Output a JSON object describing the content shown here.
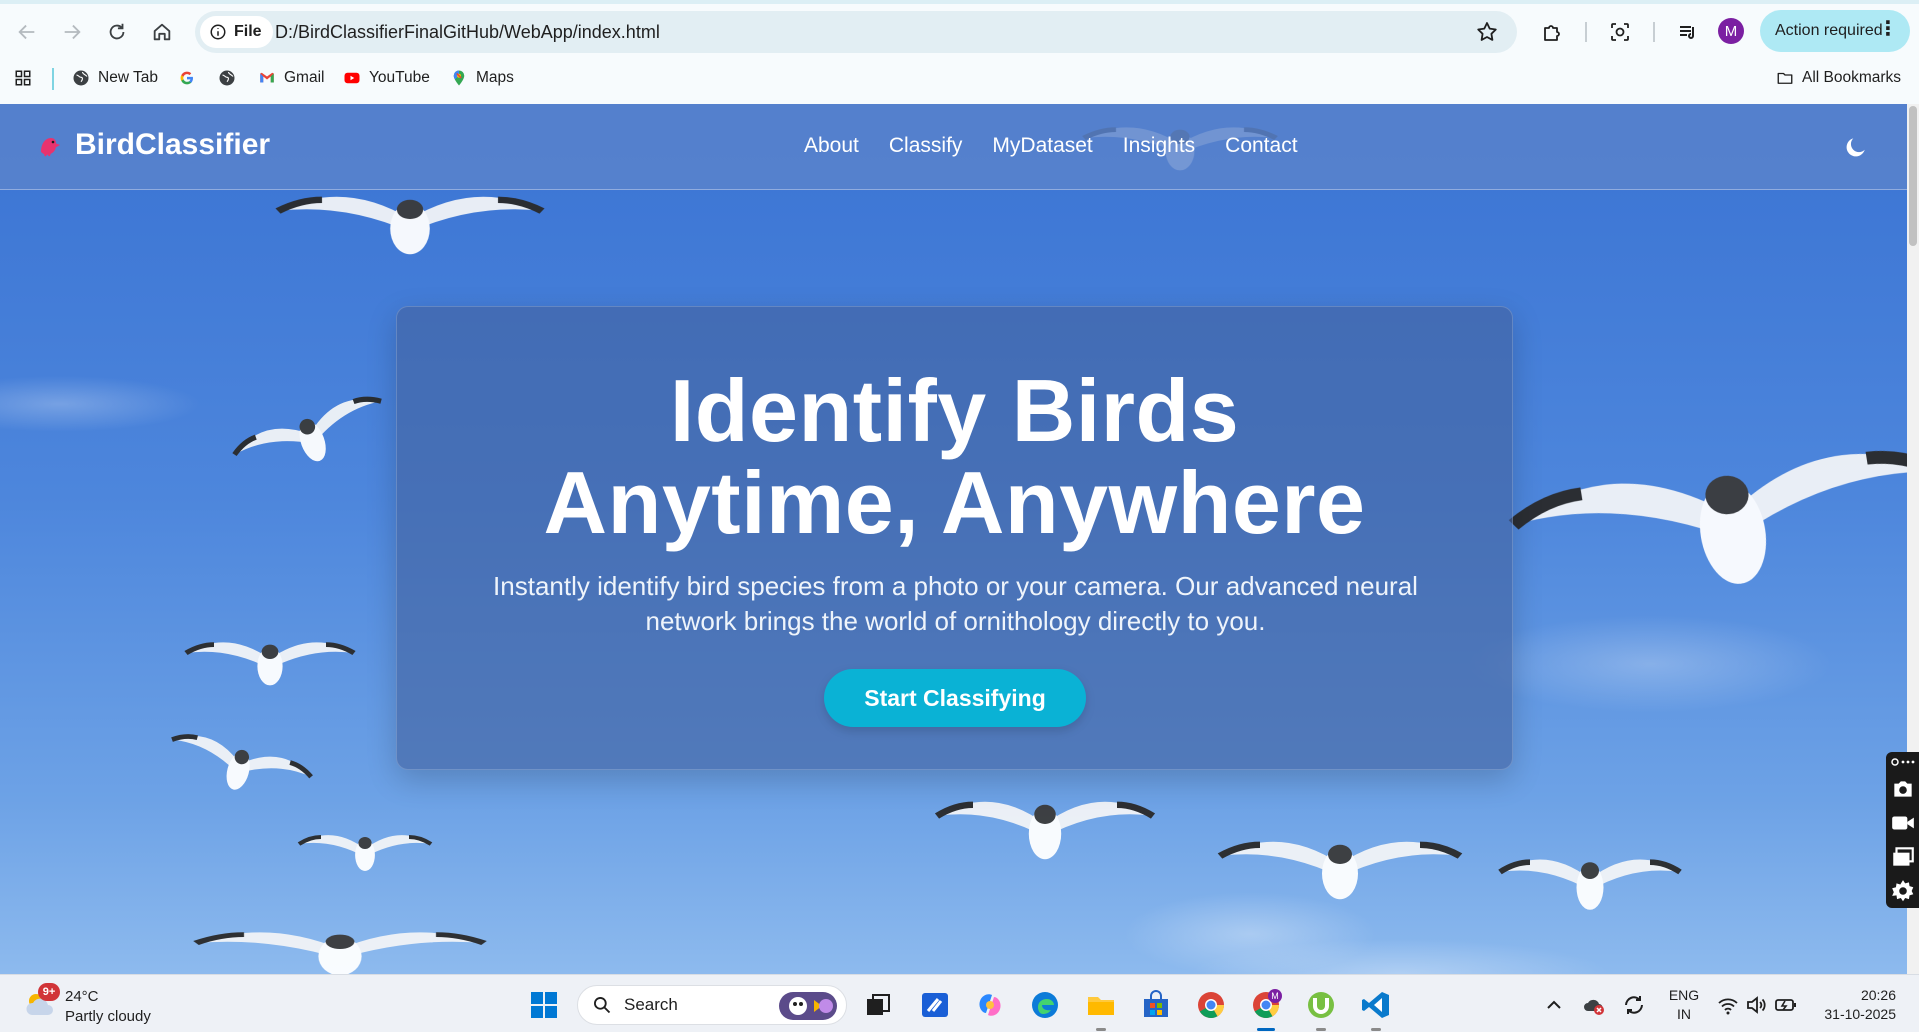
{
  "browser": {
    "url_chip": "File",
    "url": "D:/BirdClassifierFinalGitHub/WebApp/index.html",
    "profile_initial": "M",
    "action_label": "Action required"
  },
  "bookmarks": {
    "items": [
      {
        "label": "New Tab",
        "icon": "globe-icon"
      },
      {
        "label": "",
        "icon": "google-icon"
      },
      {
        "label": "",
        "icon": "globe-icon"
      },
      {
        "label": "Gmail",
        "icon": "gmail-icon"
      },
      {
        "label": "YouTube",
        "icon": "youtube-icon"
      },
      {
        "label": "Maps",
        "icon": "maps-icon"
      }
    ],
    "all_bookmarks": "All Bookmarks"
  },
  "site": {
    "brand": "BirdClassifier",
    "nav": [
      "About",
      "Classify",
      "MyDataset",
      "Insights",
      "Contact"
    ],
    "hero": {
      "title_line1": "Identify Birds",
      "title_line2": "Anytime, Anywhere",
      "subtitle_line1": "Instantly identify bird species from a photo or your camera. Our advanced neural",
      "subtitle_line2": "network brings the world of ornithology directly to you.",
      "cta": "Start Classifying"
    }
  },
  "taskbar": {
    "weather_badge": "9+",
    "weather_temp": "24°C",
    "weather_condition": "Partly cloudy",
    "search_placeholder": "Search",
    "language_line1": "ENG",
    "language_line2": "IN",
    "time": "20:26",
    "date": "31-10-2025",
    "chrome_badge": "M"
  },
  "colors": {
    "accent_cta": "#0ab2d5",
    "action_required_bg": "#aee9f4",
    "profile_avatar": "#7b1fa2"
  }
}
